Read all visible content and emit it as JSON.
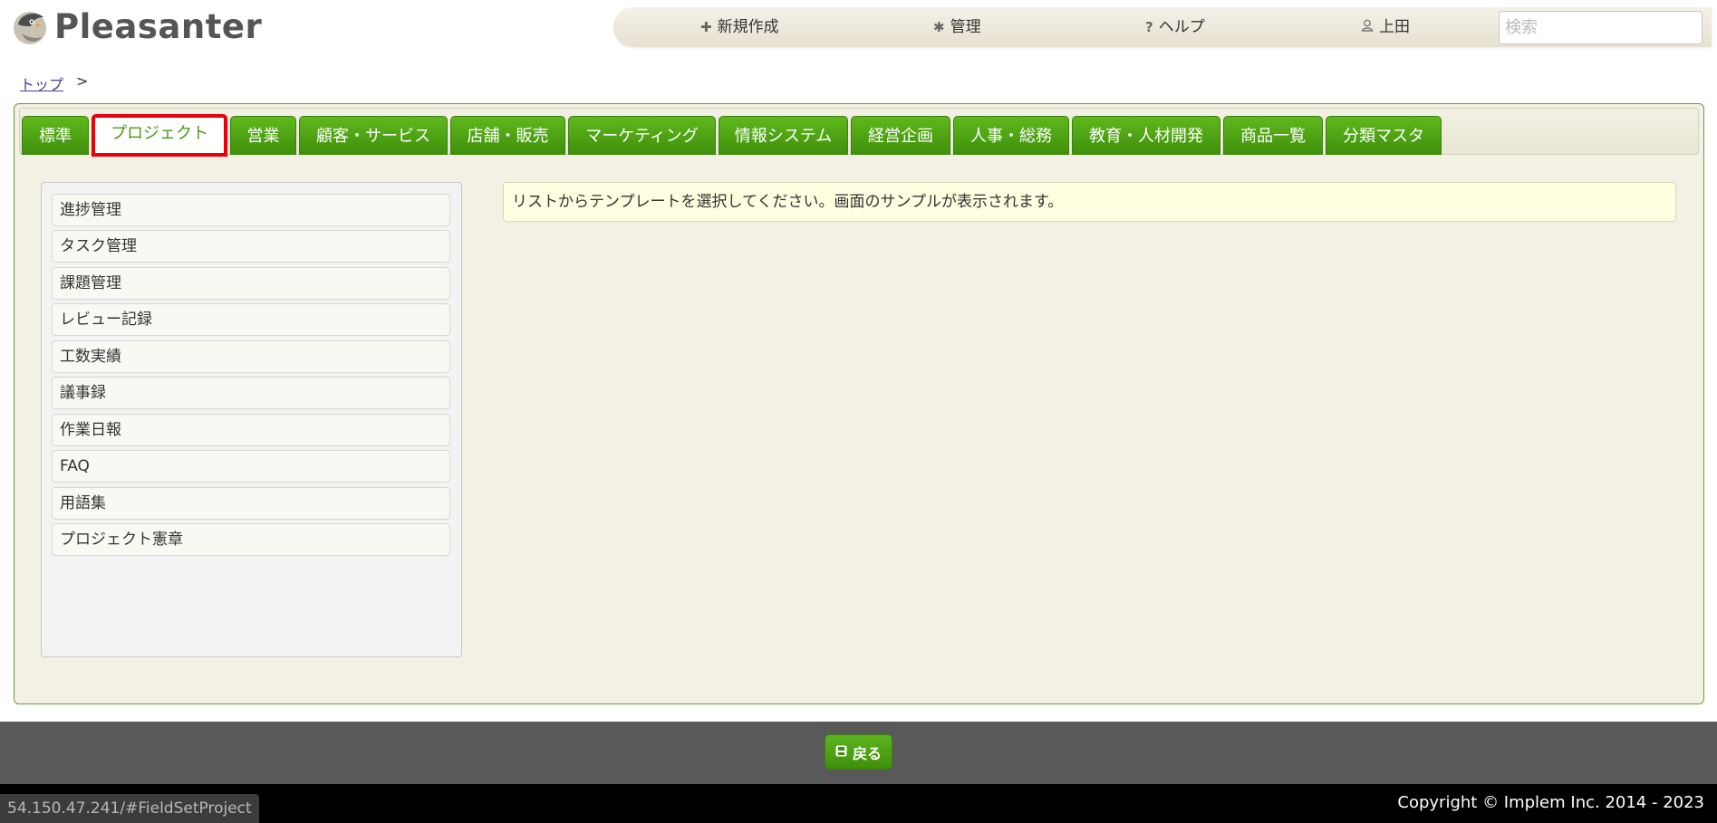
{
  "header": {
    "logo_text": "Pleasanter",
    "nav": {
      "new_label": "新規作成",
      "admin_label": "管理",
      "help_label": "ヘルプ",
      "user_label": "上田"
    },
    "search_placeholder": "検索"
  },
  "breadcrumb": {
    "top_label": "トップ",
    "separator": ">"
  },
  "tabs": [
    {
      "label": "標準"
    },
    {
      "label": "プロジェクト",
      "active": true
    },
    {
      "label": "営業"
    },
    {
      "label": "顧客・サービス"
    },
    {
      "label": "店舗・販売"
    },
    {
      "label": "マーケティング"
    },
    {
      "label": "情報システム"
    },
    {
      "label": "経営企画"
    },
    {
      "label": "人事・総務"
    },
    {
      "label": "教育・人材開発"
    },
    {
      "label": "商品一覧"
    },
    {
      "label": "分類マスタ"
    }
  ],
  "templates": [
    {
      "label": "進捗管理"
    },
    {
      "label": "タスク管理"
    },
    {
      "label": "課題管理"
    },
    {
      "label": "レビュー記録"
    },
    {
      "label": "工数実績"
    },
    {
      "label": "議事録"
    },
    {
      "label": "作業日報"
    },
    {
      "label": "FAQ"
    },
    {
      "label": "用語集"
    },
    {
      "label": "プロジェクト憲章"
    }
  ],
  "message": "リストからテンプレートを選択してください。画面のサンプルが表示されます。",
  "footer": {
    "back_label": "戻る",
    "copyright": "Copyright © Implem Inc. 2014 - 2023",
    "status_url": "54.150.47.241/#FieldSetProject"
  },
  "colors": {
    "tab_green": "#4ea516",
    "frame_bg": "#f3f1e4",
    "active_outline": "#e8000b",
    "footer_bar": "#595959"
  }
}
